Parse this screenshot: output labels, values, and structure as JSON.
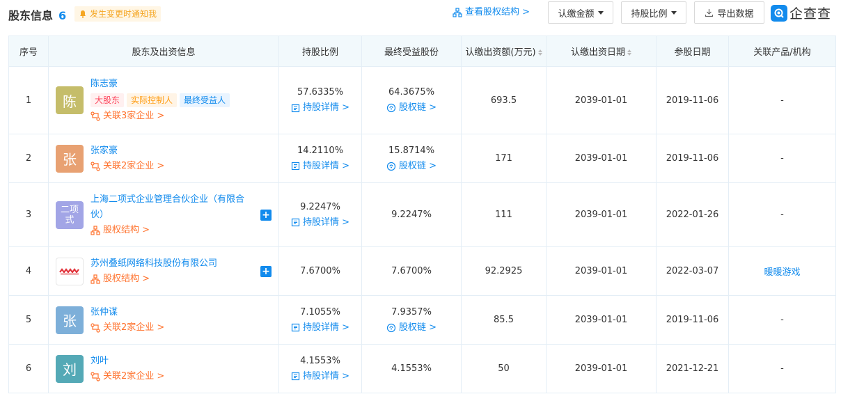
{
  "header": {
    "title": "股东信息",
    "count": "6",
    "notify": "发生变更时通知我",
    "equity_link": "查看股权结构 >",
    "btn_amount": "认缴金额",
    "btn_ratio": "持股比例",
    "btn_export": "导出数据",
    "logo_text": "企查查"
  },
  "columns": [
    "序号",
    "股东及出资信息",
    "持股比例",
    "最终受益股份",
    "认缴出资额(万元)",
    "认缴出资日期",
    "参股日期",
    "关联产品/机构"
  ],
  "rows": [
    {
      "no": "1",
      "avatar": "陈",
      "avatar_color": "#c5bd6a",
      "name": "陈志豪",
      "tags": [
        "大股东",
        "实际控制人",
        "最终受益人"
      ],
      "sub": "关联3家企业 >",
      "ratio": "57.6335%",
      "ratio_link": "持股详情 >",
      "benefit": "64.3675%",
      "benefit_link": "股权链 >",
      "amount": "693.5",
      "date": "2039-01-01",
      "join": "2019-11-06",
      "product": "-"
    },
    {
      "no": "2",
      "avatar": "张",
      "avatar_color": "#e8a172",
      "name": "张家豪",
      "sub": "关联2家企业 >",
      "ratio": "14.2110%",
      "ratio_link": "持股详情 >",
      "benefit": "15.8714%",
      "benefit_link": "股权链 >",
      "amount": "171",
      "date": "2039-01-01",
      "join": "2019-11-06",
      "product": "-"
    },
    {
      "no": "3",
      "avatar": "二项式",
      "avatar_color": "#a2a5e6",
      "name": "上海二项式企业管理合伙企业（有限合伙）",
      "sub": "股权结构 >",
      "ratio": "9.2247%",
      "ratio_link": "持股详情 >",
      "benefit": "9.2247%",
      "amount": "111",
      "date": "2039-01-01",
      "join": "2022-01-26",
      "product": "-"
    },
    {
      "no": "4",
      "name": "苏州叠纸网络科技股份有限公司",
      "sub": "股权结构 >",
      "ratio": "7.6700%",
      "benefit": "7.6700%",
      "amount": "92.2925",
      "date": "2039-01-01",
      "join": "2022-03-07",
      "product": "暖暖游戏"
    },
    {
      "no": "5",
      "avatar": "张",
      "avatar_color": "#7dafd9",
      "name": "张仲谋",
      "sub": "关联2家企业 >",
      "ratio": "7.1055%",
      "ratio_link": "持股详情 >",
      "benefit": "7.9357%",
      "benefit_link": "股权链 >",
      "amount": "85.5",
      "date": "2039-01-01",
      "join": "2019-11-06",
      "product": "-"
    },
    {
      "no": "6",
      "avatar": "刘",
      "avatar_color": "#54a9b6",
      "name": "刘叶",
      "sub": "关联2家企业 >",
      "ratio": "4.1553%",
      "ratio_link": "持股详情 >",
      "benefit": "4.1553%",
      "amount": "50",
      "date": "2039-01-01",
      "join": "2021-12-21",
      "product": "-"
    }
  ]
}
